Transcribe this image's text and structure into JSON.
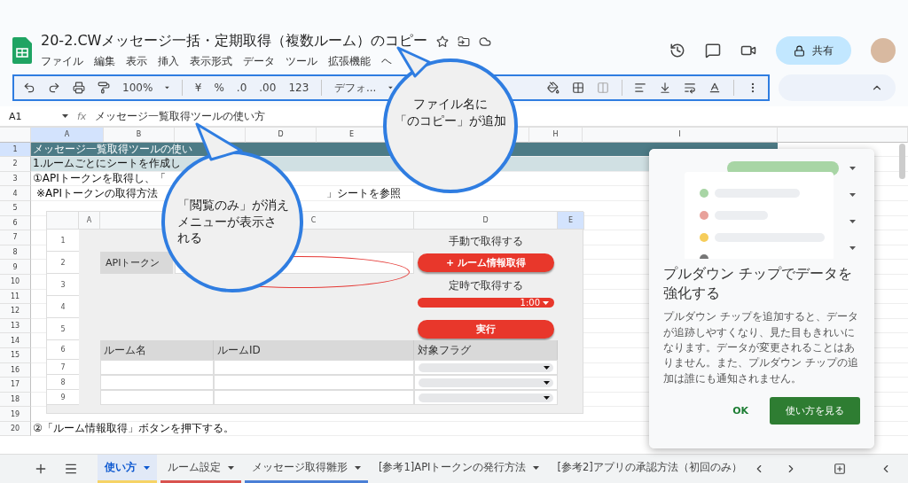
{
  "document": {
    "title": "20-2.CWメッセージ一括・定期取得（複数ルーム）のコピー"
  },
  "menu": [
    "ファイル",
    "編集",
    "表示",
    "挿入",
    "表示形式",
    "データ",
    "ツール",
    "拡張機能",
    "ヘ"
  ],
  "share_button": "共有",
  "toolbar": {
    "zoom": "100%",
    "currency": "¥",
    "percent": "%",
    "decrease_decimal": ".0",
    "increase_decimal": ".00",
    "number_format": "123",
    "font": "デフォ..."
  },
  "formula_bar": {
    "cell_ref": "A1",
    "function_label": "fx",
    "content": "メッセージ一覧取得ツールの使い方"
  },
  "columns": [
    {
      "label": "A",
      "selected": true
    },
    {
      "label": "B",
      "selected": false
    },
    {
      "selected": false
    },
    {
      "label": "D",
      "selected": false
    },
    {
      "label": "E",
      "selected": false
    },
    {},
    {
      "selected": false
    },
    {
      "label": "H",
      "selected": false
    },
    {
      "label": "I",
      "selected": false
    }
  ],
  "rows": [
    {
      "number": "1",
      "selected": true,
      "kind": "title",
      "text": "メッセージ一覧取得ツールの使い"
    },
    {
      "number": "2",
      "selected": false,
      "kind": "section",
      "text": "1.ルームごとにシートを作成し"
    },
    {
      "number": "3",
      "selected": false,
      "kind": "plain",
      "text": "①APIトークンを取得し、「"
    },
    {
      "number": "4",
      "selected": false,
      "kind": "note",
      "text": "※APIトークンの取得方法",
      "tail": "」シートを参照"
    },
    {
      "number": "5",
      "selected": false,
      "kind": "plain"
    },
    {
      "number": "6",
      "selected": false,
      "kind": "plain"
    },
    {
      "number": "7",
      "selected": false,
      "kind": "plain"
    },
    {
      "number": "8",
      "selected": false,
      "kind": "plain"
    },
    {
      "number": "9",
      "selected": false,
      "kind": "plain"
    },
    {
      "number": "10",
      "selected": false,
      "kind": "plain"
    },
    {
      "number": "11",
      "selected": false,
      "kind": "plain"
    },
    {
      "number": "12",
      "selected": false,
      "kind": "plain"
    },
    {
      "number": "13",
      "selected": false,
      "kind": "plain"
    },
    {
      "number": "14",
      "selected": false,
      "kind": "plain"
    },
    {
      "number": "15",
      "selected": false,
      "kind": "plain"
    },
    {
      "number": "16",
      "selected": false,
      "kind": "plain"
    },
    {
      "number": "17",
      "selected": false,
      "kind": "plain"
    },
    {
      "number": "18",
      "selected": false,
      "kind": "plain"
    },
    {
      "number": "19",
      "selected": false,
      "kind": "plain"
    },
    {
      "number": "20",
      "selected": false,
      "kind": "plain",
      "text": "②「ルーム情報取得」ボタンを押下する。"
    }
  ],
  "embedded_sheet": {
    "columns": [
      {
        "label": "A"
      },
      {},
      {
        "label": "C"
      },
      {
        "label": "D"
      },
      {
        "label": "E",
        "selected": true
      }
    ],
    "rows": [
      "1",
      "2",
      "3",
      "4",
      "5",
      "6",
      "7",
      "8",
      "9"
    ],
    "token_label": "APIトークン",
    "manual_label": "手動で取得する",
    "fetch_button": "+ ルーム情報取得",
    "schedule_label": "定時で取得する",
    "schedule_time": "1:00",
    "run_button": "実行",
    "table_headers": [
      "ルーム名",
      "ルームID",
      "対象フラグ"
    ]
  },
  "callouts": [
    {
      "lines": [
        "ファイル名に",
        "「のコピー」が追加"
      ]
    },
    {
      "lines": [
        "「閲覧のみ」が消え",
        "メニューが表示さ",
        "れる"
      ]
    }
  ],
  "dialog": {
    "title": "プルダウン チップでデータを強化する",
    "body": "プルダウン チップを追加すると、データが追跡しやすくなり、見た目もきれいになります。データが変更されることはありません。また、プルダウン チップの追加は誰にも通知されません。",
    "ok": "OK",
    "learn_more": "使い方を見る"
  },
  "sheet_tabs": [
    {
      "label": "使い方",
      "selected": true,
      "color": "#f6d365"
    },
    {
      "label": "ルーム設定",
      "selected": false,
      "color": "#d9534f"
    },
    {
      "label": "メッセージ取得雛形",
      "selected": false,
      "color": "#4a7fd6"
    },
    {
      "label": "[参考1]APIトークンの発行方法",
      "selected": false
    },
    {
      "label": "[参考2]アプリの承認方法（初回のみ）",
      "selected": false
    }
  ]
}
